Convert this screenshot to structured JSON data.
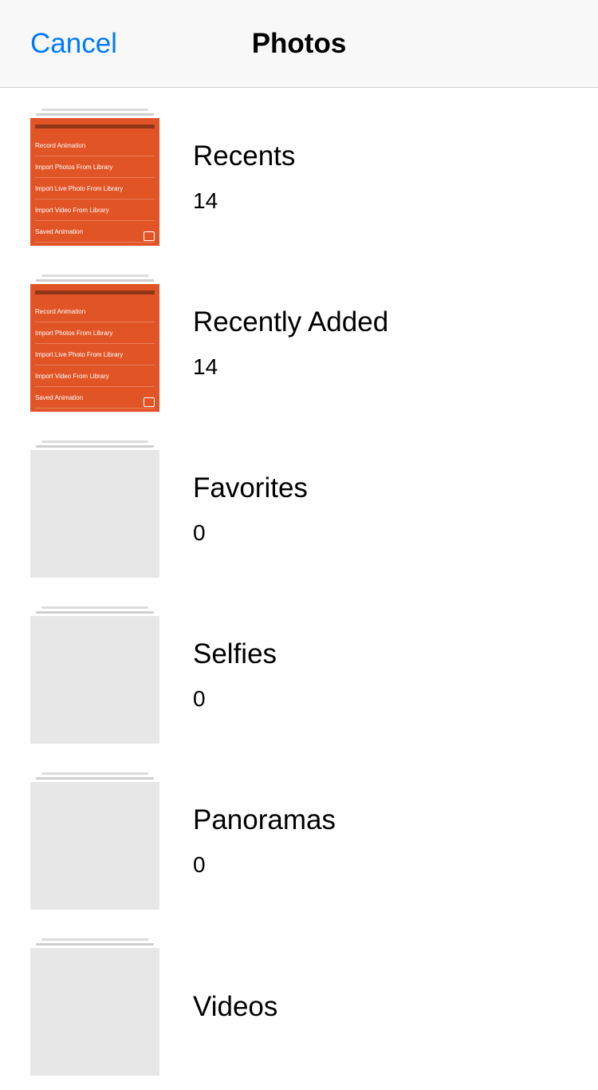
{
  "header": {
    "cancel_label": "Cancel",
    "title": "Photos"
  },
  "albums": [
    {
      "name": "Recents",
      "count": "14",
      "thumb_style": "orange"
    },
    {
      "name": "Recently Added",
      "count": "14",
      "thumb_style": "orange"
    },
    {
      "name": "Favorites",
      "count": "0",
      "thumb_style": "empty"
    },
    {
      "name": "Selfies",
      "count": "0",
      "thumb_style": "empty"
    },
    {
      "name": "Panoramas",
      "count": "0",
      "thumb_style": "empty"
    },
    {
      "name": "Videos",
      "count": "",
      "thumb_style": "empty"
    }
  ],
  "thumb_lines": [
    "Record Animation",
    "Import Photos From Library",
    "Import Live Photo From Library",
    "Import Video From Library",
    "Saved Animation"
  ]
}
